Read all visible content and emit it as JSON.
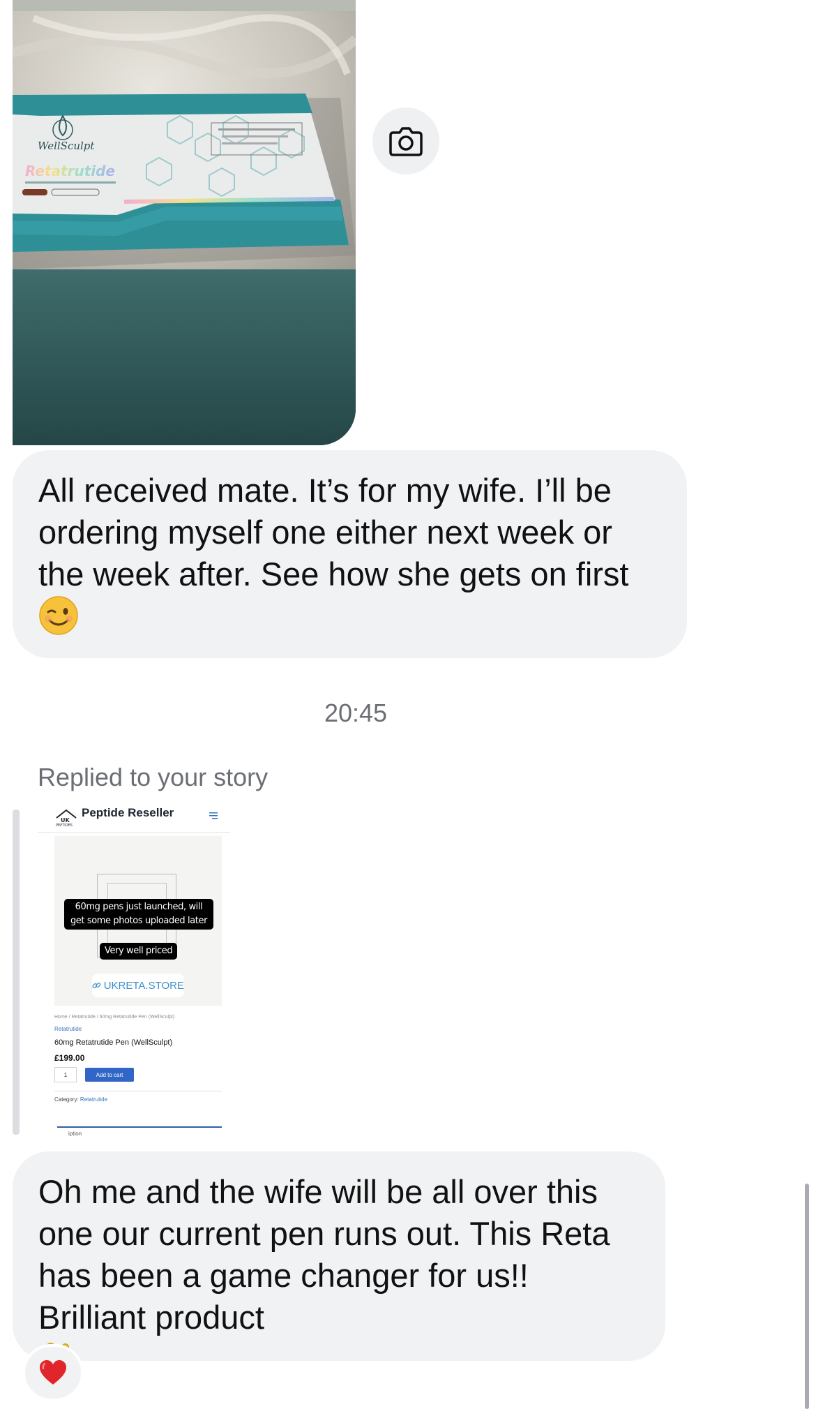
{
  "messages": {
    "photo": {
      "alt": "",
      "box_brand": "WellSculpt",
      "box_product": "Retatrutide"
    },
    "message_1": {
      "text": "All received mate. It’s for my wife. I’ll be ordering myself one either next week or the week after. See how she gets on first",
      "emoji": "winking-face"
    },
    "timestamp": "20:45",
    "story_reply": {
      "label": "Replied to your story",
      "site_title": "Peptide Reseller",
      "logo_text": "UK PEPTIDES",
      "sticker_1": "60mg pens just launched, will get some photos uploaded later",
      "sticker_2": "Very well priced",
      "link_label": "UKRETA.STORE",
      "breadcrumb": "Home / Retatrutide / 60mg Retatrutide Pen (WellSculpt)",
      "category_link": "Retatrutide",
      "product_title": "60mg Retatrutide Pen (WellSculpt)",
      "price": "£199.00",
      "quantity": "1",
      "add_to_cart": "Add to cart",
      "category_label": "Category:",
      "category_value": "Retatrutide",
      "tab_partial": "iption"
    },
    "message_2": {
      "text": "Oh me and the wife will be all over this one our current pen runs out. This Reta has been a game changer for us!! Brilliant product",
      "emoji": "ok-hand"
    },
    "reaction": {
      "emoji": "red-heart"
    }
  },
  "colors": {
    "bubble": "#f1f2f4",
    "secondary_text": "#6b6e74",
    "link_blue": "#3d8fc8",
    "button_blue": "#3166c6",
    "box_teal": "#2f8f97"
  }
}
